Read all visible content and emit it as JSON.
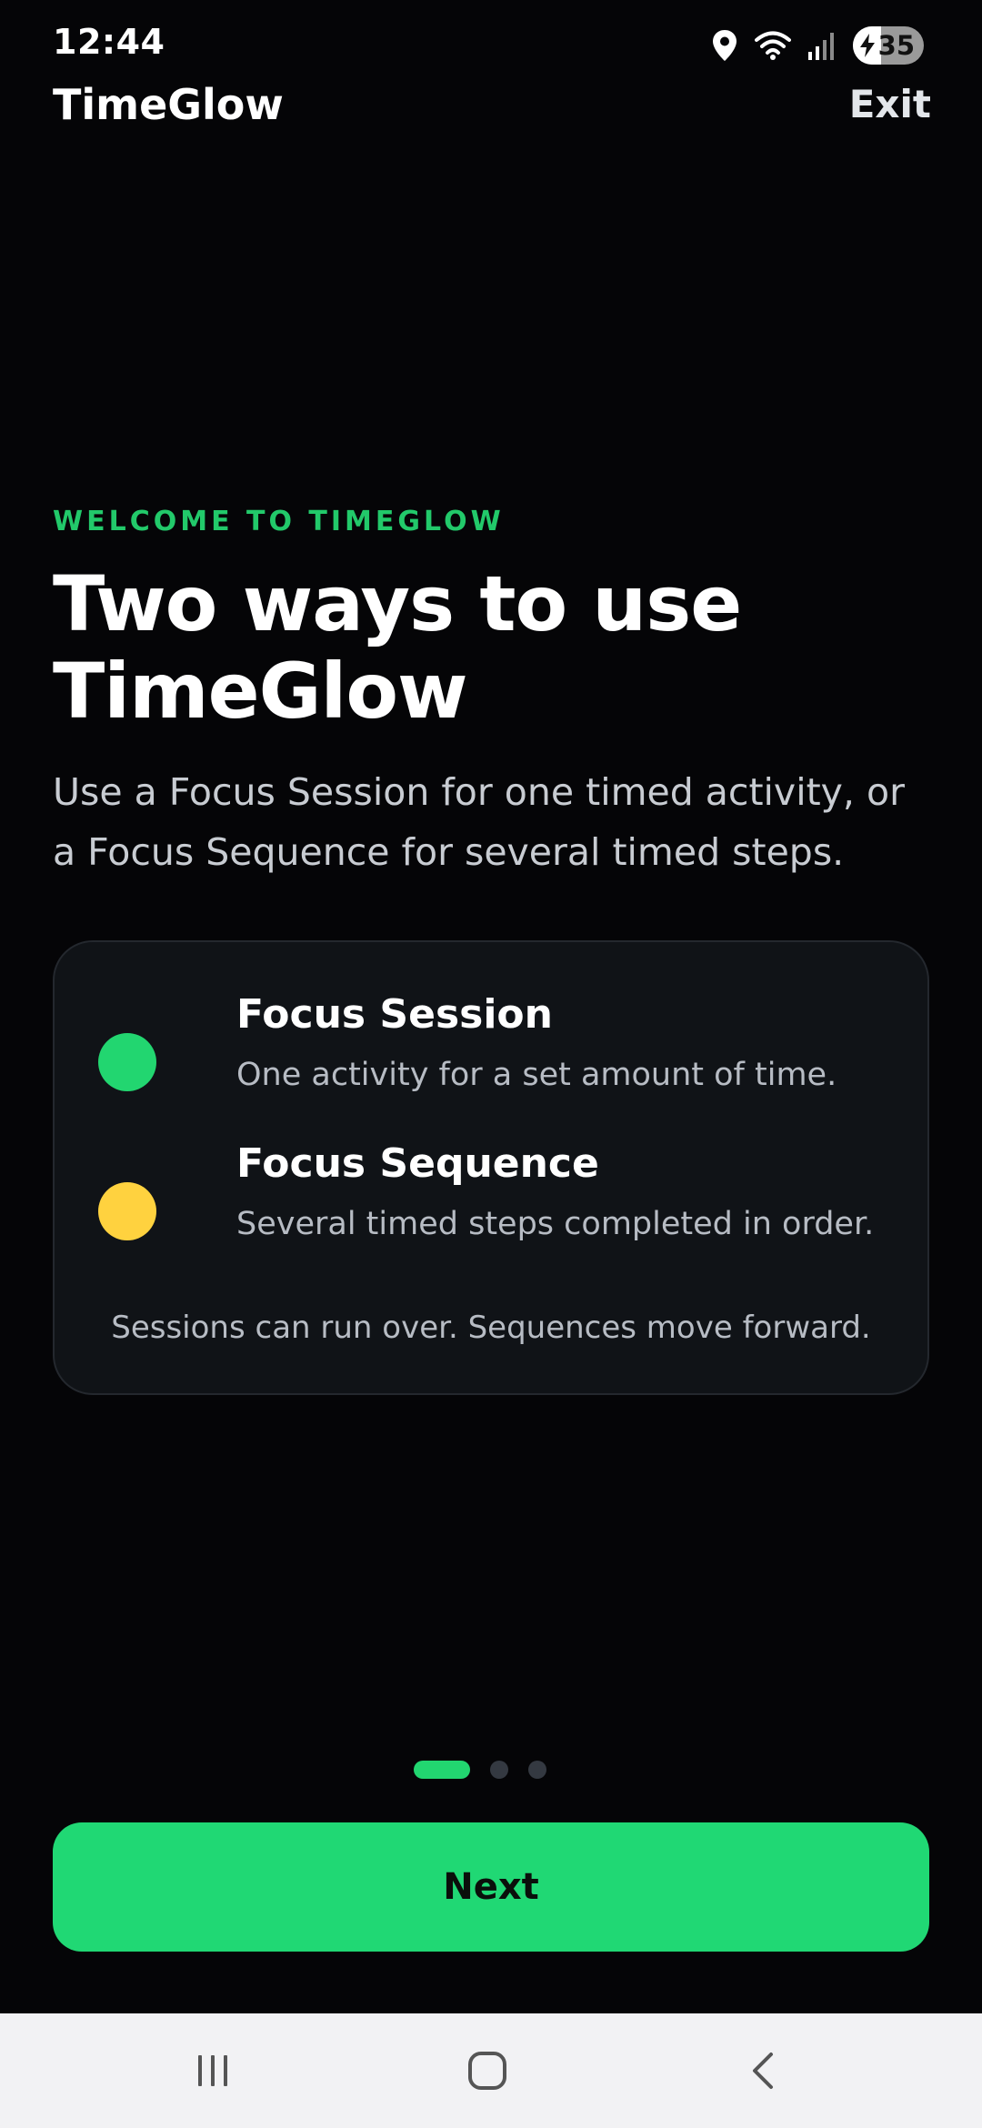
{
  "status_bar": {
    "time": "12:44",
    "battery_percent": "35",
    "icons": [
      "location-icon",
      "wifi-icon",
      "signal-icon",
      "battery-charging-icon"
    ]
  },
  "app_bar": {
    "title": "TimeGlow",
    "exit_label": "Exit"
  },
  "hero": {
    "eyebrow": "WELCOME TO TIMEGLOW",
    "headline": "Two ways to use TimeGlow",
    "subtitle": "Use a Focus Session for one timed activity, or a Focus Sequence for several timed steps."
  },
  "modes": {
    "session": {
      "title": "Focus Session",
      "description": "One activity for a set amount of time.",
      "color": "#22d670"
    },
    "sequence": {
      "title": "Focus Sequence",
      "description": "Several timed steps completed in order.",
      "color": "#ffd23f"
    },
    "footnote": "Sessions can run over. Sequences move forward."
  },
  "pager": {
    "total_pages": 3,
    "current_page": 1
  },
  "actions": {
    "next_label": "Next"
  },
  "colors": {
    "accent": "#22d670",
    "background": "#050507",
    "card": "#101317"
  },
  "nav_bar": {
    "icons": [
      "recents-icon",
      "home-icon",
      "back-icon"
    ]
  }
}
